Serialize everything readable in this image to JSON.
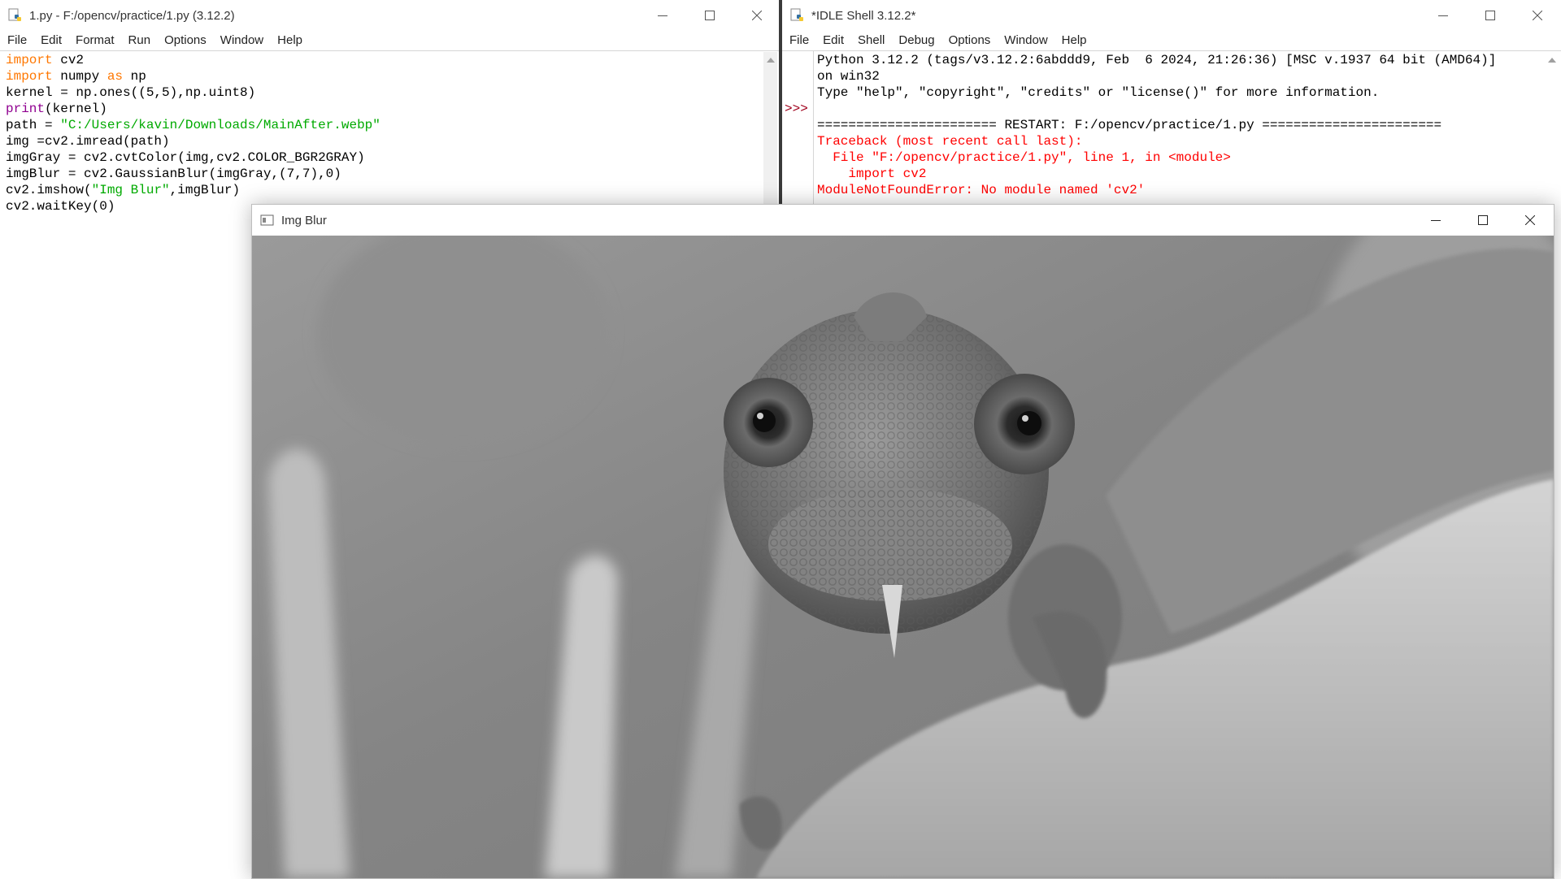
{
  "editor": {
    "title": "1.py - F:/opencv/practice/1.py (3.12.2)",
    "menu": [
      "File",
      "Edit",
      "Format",
      "Run",
      "Options",
      "Window",
      "Help"
    ],
    "lines": [
      [
        {
          "t": "import",
          "c": "kw"
        },
        {
          "t": " cv2"
        }
      ],
      [
        {
          "t": "import",
          "c": "kw"
        },
        {
          "t": " numpy "
        },
        {
          "t": "as",
          "c": "kw"
        },
        {
          "t": " np"
        }
      ],
      [
        {
          "t": "kernel = np.ones((5,5),np.uint8)"
        }
      ],
      [
        {
          "t": "print",
          "c": "bi"
        },
        {
          "t": "(kernel)"
        }
      ],
      [
        {
          "t": "path = "
        },
        {
          "t": "\"C:/Users/kavin/Downloads/MainAfter.webp\"",
          "c": "str"
        }
      ],
      [
        {
          "t": "img =cv2.imread(path)"
        }
      ],
      [
        {
          "t": "imgGray = cv2.cvtColor(img,cv2.COLOR_BGR2GRAY)"
        }
      ],
      [
        {
          "t": "imgBlur = cv2.GaussianBlur(imgGray,(7,7),0)"
        }
      ],
      [
        {
          "t": "cv2.imshow("
        },
        {
          "t": "\"Img Blur\"",
          "c": "str"
        },
        {
          "t": ",imgBlur)"
        }
      ],
      [
        {
          "t": "cv2.waitKey(0)"
        }
      ]
    ]
  },
  "shell": {
    "title": "*IDLE Shell 3.12.2*",
    "menu": [
      "File",
      "Edit",
      "Shell",
      "Debug",
      "Options",
      "Window",
      "Help"
    ],
    "prompt": ">>>",
    "lines": [
      [
        {
          "t": "Python 3.12.2 (tags/v3.12.2:6abddd9, Feb  6 2024, 21:26:36) [MSC v.1937 64 bit (AMD64)]"
        }
      ],
      [
        {
          "t": "on win32"
        }
      ],
      [
        {
          "t": "Type \"help\", \"copyright\", \"credits\" or \"license()\" for more information."
        }
      ],
      [
        {
          "t": ""
        }
      ],
      [
        {
          "t": "======================= RESTART: F:/opencv/practice/1.py ======================="
        }
      ],
      [
        {
          "t": "Traceback (most recent call last):",
          "c": "err"
        }
      ],
      [
        {
          "t": "  File \"F:/opencv/practice/1.py\", line 1, in <module>",
          "c": "err"
        }
      ],
      [
        {
          "t": "    import cv2",
          "c": "err"
        }
      ],
      [
        {
          "t": "ModuleNotFoundError: No module named 'cv2'",
          "c": "err"
        }
      ]
    ]
  },
  "imgwin": {
    "title": "Img Blur"
  },
  "icons": {
    "python": "python-icon",
    "opencv": "opencv-window-icon",
    "minimize": "minimize-icon",
    "maximize": "maximize-icon",
    "close": "close-icon"
  },
  "colors": {
    "keyword": "#ff7700",
    "builtin": "#900090",
    "string": "#00aa00",
    "error": "#ff0000",
    "prompt": "#a0001c"
  }
}
